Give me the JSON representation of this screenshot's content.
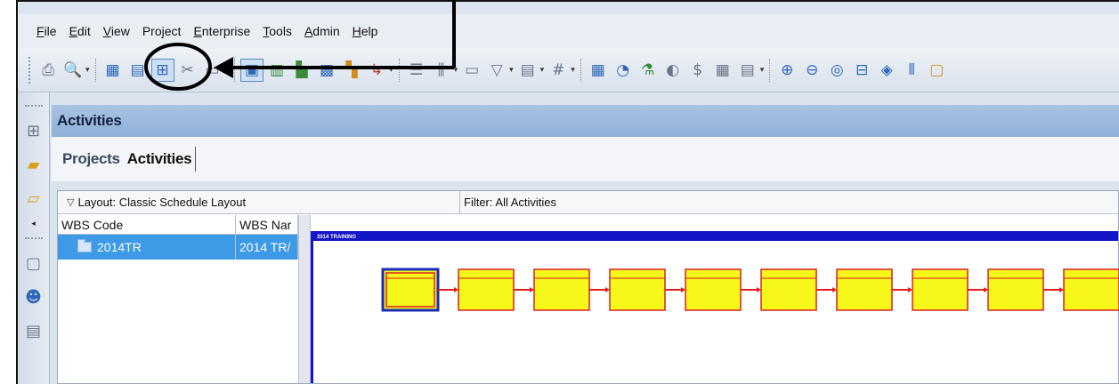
{
  "menu": [
    {
      "pre": "",
      "u": "F",
      "post": "ile"
    },
    {
      "pre": "",
      "u": "E",
      "post": "dit"
    },
    {
      "pre": "",
      "u": "V",
      "post": "iew"
    },
    {
      "pre": "Pro",
      "u": "j",
      "post": "ect"
    },
    {
      "pre": "",
      "u": "E",
      "post": "nterprise"
    },
    {
      "pre": "",
      "u": "T",
      "post": "ools"
    },
    {
      "pre": "",
      "u": "A",
      "post": "dmin"
    },
    {
      "pre": "",
      "u": "H",
      "post": "elp"
    }
  ],
  "header": {
    "title": "Activities"
  },
  "tabs": [
    {
      "label": "Projects",
      "active": false
    },
    {
      "label": "Activities",
      "active": true
    }
  ],
  "layout_label": "Layout: Classic Schedule Layout",
  "filter_label": "Filter: All Activities",
  "columns": {
    "wbs_code": "WBS Code",
    "wbs_name": "WBS Nar"
  },
  "row": {
    "code": "2014TR",
    "name": "2014 TR/"
  },
  "network": {
    "title": "2014 TRAINING",
    "boxes": 10,
    "selected_index": 0
  },
  "colors": {
    "box_fill": "#f7f71a",
    "box_border": "#d82121",
    "link": "#e21c1c",
    "selected_border": "#1d2bb8",
    "frame_blue": "#1414c8"
  },
  "icons": [
    "print-icon",
    "print-preview-icon",
    "table-view-icon",
    "gantt-icon",
    "network-view-icon",
    "cut-icon",
    "paste-icon",
    "activity-details-icon",
    "wbs-icon",
    "resources-icon",
    "codes-icon",
    "steps-icon",
    "relationships-icon",
    "format-icon",
    "columns-icon",
    "bars-icon",
    "filter-icon",
    "group-sort-icon",
    "number-icon",
    "schedule-icon",
    "level-icon",
    "summarize-icon",
    "store-period-icon",
    "budget-icon",
    "calendar-icon",
    "layout-icon",
    "zoom-in-icon",
    "zoom-out-icon",
    "zoom-fit-icon",
    "split-icon",
    "diamond-icon",
    "columns-panel-icon",
    "notes-icon"
  ]
}
